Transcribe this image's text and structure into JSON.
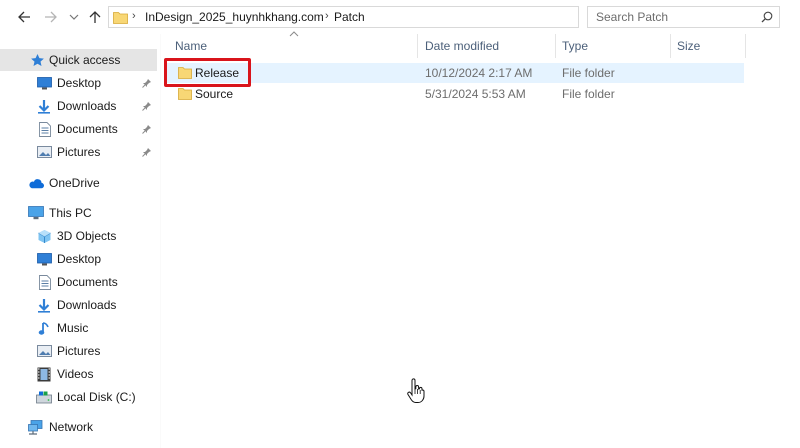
{
  "toolbar": {
    "back_icon": "arrow-left-icon",
    "forward_icon": "arrow-right-icon",
    "up_icon": "arrow-up-icon"
  },
  "address": {
    "crumbs": [
      "InDesign_2025_huynhkhang.com",
      "Patch"
    ]
  },
  "search": {
    "placeholder": "Search Patch"
  },
  "columns": {
    "name": "Name",
    "date": "Date modified",
    "type": "Type",
    "size": "Size"
  },
  "sidebar": {
    "items": [
      {
        "label": "Quick access",
        "icon": "star-icon"
      },
      {
        "label": "Desktop",
        "icon": "desktop-icon"
      },
      {
        "label": "Downloads",
        "icon": "download-icon"
      },
      {
        "label": "Documents",
        "icon": "document-icon"
      },
      {
        "label": "Pictures",
        "icon": "pictures-icon"
      },
      {
        "label": "OneDrive",
        "icon": "cloud-icon"
      },
      {
        "label": "This PC",
        "icon": "computer-icon"
      },
      {
        "label": "3D Objects",
        "icon": "cube-icon"
      },
      {
        "label": "Desktop",
        "icon": "desktop-icon"
      },
      {
        "label": "Documents",
        "icon": "document-icon"
      },
      {
        "label": "Downloads",
        "icon": "download-icon"
      },
      {
        "label": "Music",
        "icon": "music-icon"
      },
      {
        "label": "Pictures",
        "icon": "pictures-icon"
      },
      {
        "label": "Videos",
        "icon": "video-icon"
      },
      {
        "label": "Local Disk (C:)",
        "icon": "drive-icon"
      },
      {
        "label": "Network",
        "icon": "network-icon"
      }
    ]
  },
  "files": [
    {
      "name": "Release",
      "date": "10/12/2024 2:17 AM",
      "type": "File folder",
      "size": ""
    },
    {
      "name": "Source",
      "date": "5/31/2024 5:53 AM",
      "type": "File folder",
      "size": ""
    }
  ],
  "colors": {
    "accent_highlight": "#d9141b",
    "selection": "#e5f3ff",
    "folder": "#f8d775",
    "header_text": "#4c607a"
  }
}
